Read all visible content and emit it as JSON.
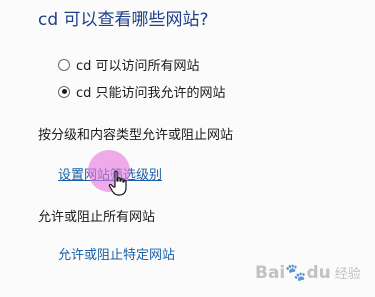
{
  "title": "cd 可以查看哪些网站?",
  "radios": [
    {
      "label": "cd 可以访问所有网站",
      "checked": false
    },
    {
      "label": "cd 只能访问我允许的网站",
      "checked": true
    }
  ],
  "section1": {
    "label": "按分级和内容类型允许或阻止网站",
    "link": "设置网站筛选级别"
  },
  "section2": {
    "label": "允许或阻止所有网站",
    "link": "允许或阻止特定网站"
  },
  "watermark": {
    "brand": "Bai",
    "paw": "🐾",
    "suffix": "du",
    "sub": "经验"
  },
  "colors": {
    "title": "#1e3f8a",
    "link": "#1a5fa8",
    "highlight": "#e778de"
  }
}
